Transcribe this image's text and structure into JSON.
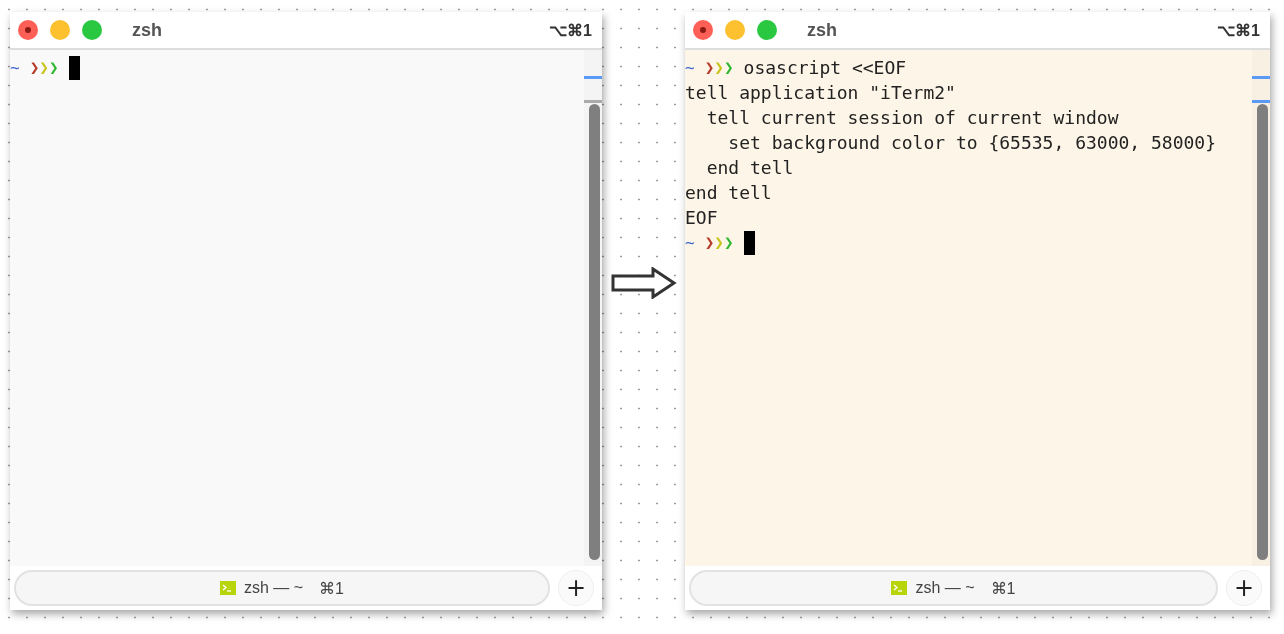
{
  "windows": [
    {
      "title": "zsh",
      "shortcut": "⌥⌘1",
      "color": "#f9f9f9",
      "lines": [
        {
          "kind": "prompt",
          "tilde": "~",
          "chevrons": [
            "❯",
            "❯",
            "❯"
          ],
          "cursor": true
        }
      ],
      "tab": {
        "label": "zsh — ~",
        "shortcut": "⌘1"
      },
      "new_tab": "+"
    },
    {
      "title": "zsh",
      "shortcut": "⌥⌘1",
      "color": "#fdf5e7",
      "lines": [
        {
          "kind": "prompt",
          "tilde": "~",
          "chevrons": [
            "❯",
            "❯",
            "❯"
          ],
          "command": "osascript <<EOF"
        },
        {
          "kind": "output",
          "text": "tell application \"iTerm2\""
        },
        {
          "kind": "output",
          "text": "  tell current session of current window"
        },
        {
          "kind": "output",
          "text": "    set background color to {65535, 63000, 58000}"
        },
        {
          "kind": "output",
          "text": "  end tell"
        },
        {
          "kind": "output",
          "text": "end tell"
        },
        {
          "kind": "output",
          "text": "EOF"
        },
        {
          "kind": "prompt",
          "tilde": "~",
          "chevrons": [
            "❯",
            "❯",
            "❯"
          ],
          "cursor": true
        }
      ],
      "tab": {
        "label": "zsh — ~",
        "shortcut": "⌘1"
      },
      "new_tab": "+"
    }
  ]
}
